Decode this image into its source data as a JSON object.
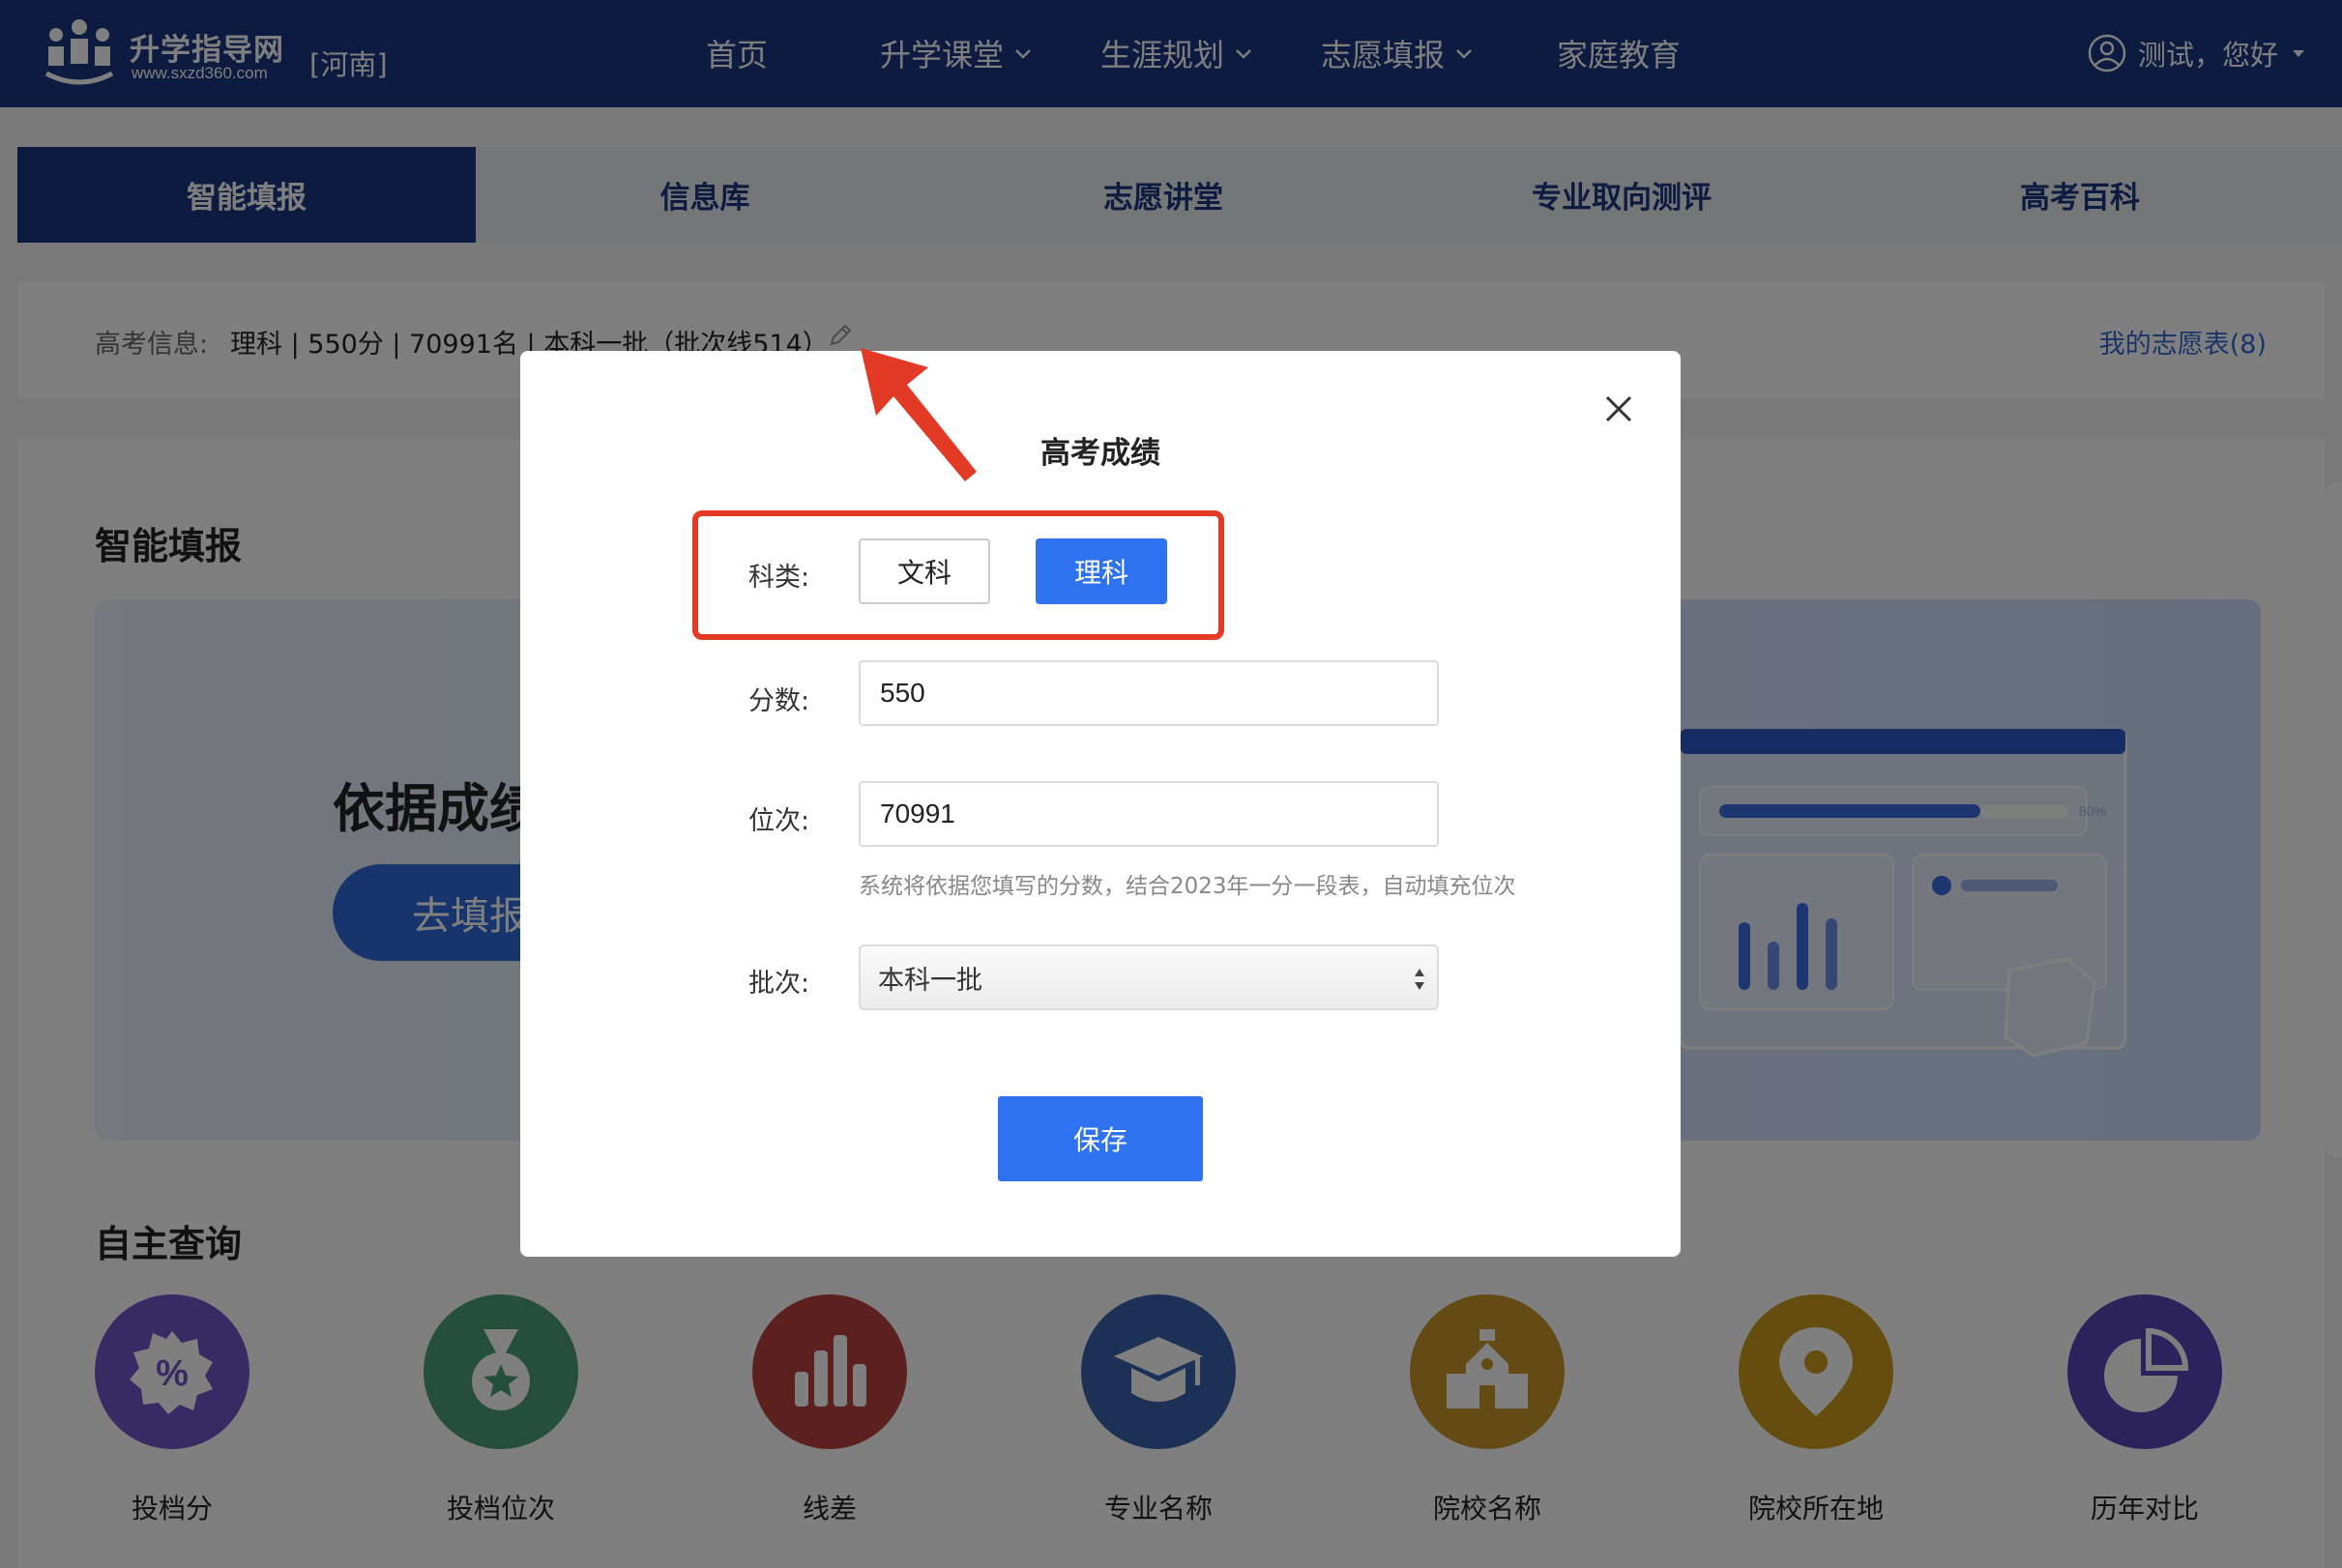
{
  "header": {
    "brand_name": "升学指导网",
    "brand_url": "www.sxzd360.com",
    "region": "[河南]",
    "nav": [
      {
        "label": "首页",
        "has_dropdown": false
      },
      {
        "label": "升学课堂",
        "has_dropdown": true
      },
      {
        "label": "生涯规划",
        "has_dropdown": true
      },
      {
        "label": "志愿填报",
        "has_dropdown": true
      },
      {
        "label": "家庭教育",
        "has_dropdown": false
      }
    ],
    "user_greeting": "测试，您好"
  },
  "tabs": [
    {
      "label": "智能填报",
      "active": true
    },
    {
      "label": "信息库",
      "active": false
    },
    {
      "label": "志愿讲堂",
      "active": false
    },
    {
      "label": "专业取向测评",
      "active": false
    },
    {
      "label": "高考百科",
      "active": false
    }
  ],
  "exam_info": {
    "label": "高考信息:",
    "value": "理科 | 550分 | 70991名 | 本科一批（批次线514）",
    "wishlist_link": "我的志愿表(8)"
  },
  "smart_fill": {
    "title": "智能填报",
    "hero_heading": "依据成绩",
    "hero_button": "去填报",
    "hero_progress_label": "80%"
  },
  "self_query": {
    "title": "自主查询",
    "items": [
      {
        "label": "投档分",
        "icon": "percent-badge-icon",
        "color": "#6e57c7"
      },
      {
        "label": "投档位次",
        "icon": "medal-icon",
        "color": "#4a9d7c"
      },
      {
        "label": "线差",
        "icon": "bar-chart-icon",
        "color": "#b9413f"
      },
      {
        "label": "专业名称",
        "icon": "graduation-cap-icon",
        "color": "#3a63ad"
      },
      {
        "label": "院校名称",
        "icon": "school-building-icon",
        "color": "#c8962c"
      },
      {
        "label": "院校所在地",
        "icon": "location-pin-icon",
        "color": "#c99a1c"
      },
      {
        "label": "历年对比",
        "icon": "pie-chart-icon",
        "color": "#5a46b8"
      }
    ]
  },
  "modal": {
    "title": "高考成绩",
    "subject_label": "科类:",
    "subject_options": [
      "文科",
      "理科"
    ],
    "subject_selected": "理科",
    "score_label": "分数:",
    "score_value": "550",
    "rank_label": "位次:",
    "rank_value": "70991",
    "rank_hint": "系统将依据您填写的分数，结合2023年一分一段表，自动填充位次",
    "batch_label": "批次:",
    "batch_value": "本科一批",
    "save_label": "保存"
  },
  "colors": {
    "nav_bg": "#1c3683",
    "primary_button": "#2f72ef",
    "link": "#3367d6",
    "annotation": "#e33a25"
  }
}
